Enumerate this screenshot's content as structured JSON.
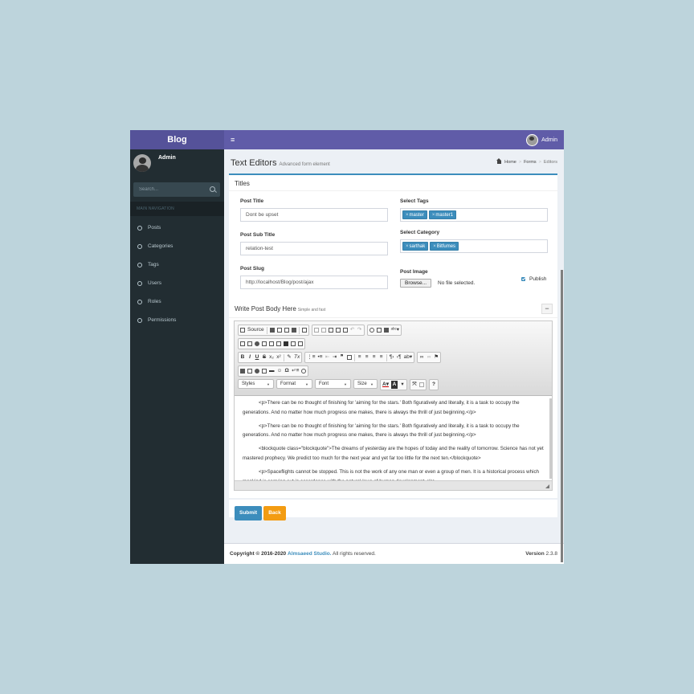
{
  "header": {
    "logo": "Blog",
    "toggle_icon": "≡",
    "user_name": "Admin"
  },
  "sidebar": {
    "user_name": "Admin",
    "search_placeholder": "Search...",
    "section_header": "MAIN NAVIGATION",
    "items": [
      {
        "label": "Posts"
      },
      {
        "label": "Categories"
      },
      {
        "label": "Tags"
      },
      {
        "label": "Users"
      },
      {
        "label": "Roles"
      },
      {
        "label": "Permissions"
      }
    ]
  },
  "page": {
    "title": "Text Editors",
    "subtitle": "Advanced form element",
    "breadcrumb": [
      "Home",
      "Forms",
      "Editors"
    ]
  },
  "titles_box": {
    "title": "Titles",
    "post_title_label": "Post Title",
    "post_title_value": "Dont be upset",
    "post_subtitle_label": "Post Sub Title",
    "post_subtitle_value": "relation-test",
    "post_slug_label": "Post Slug",
    "post_slug_value": "http://localhost/Blog/post/ajax",
    "tags_label": "Select Tags",
    "tags": [
      "master",
      "master1"
    ],
    "category_label": "Select Category",
    "categories": [
      "sarthak",
      "Bitfumes"
    ],
    "image_label": "Post Image",
    "browse_label": "Browse...",
    "file_status": "No file selected.",
    "publish_label": "Publish"
  },
  "editor_box": {
    "title": "Write Post Body Here",
    "subtitle": "Simple and fast",
    "collapse_label": "−",
    "toolbar": {
      "source_label": "Source",
      "styles": "Styles",
      "format": "Format",
      "font": "Font",
      "size": "Size",
      "help": "?"
    },
    "paragraphs": [
      "<p>There can be no thought of finishing for 'aiming for the stars.' Both figuratively and literally, it is a task to occupy the generations. And no matter how much progress one makes, there is always the thrill of just beginning.</p>",
      "<p>There can be no thought of finishing for 'aiming for the stars.' Both figuratively and literally, it is a task to occupy the generations. And no matter how much progress one makes, there is always the thrill of just beginning.</p>",
      "<blockquote class=\"blockquote\">The dreams of yesterday are the hopes of today and the reality of tomorrow. Science has not yet mastered prophecy. We predict too much for the next year and yet far too little for the next ten.</blockquote>",
      "<p>Spaceflights cannot be stopped. This is not the work of any one man or even a group of men. It is a historical process which mankind is carrying out in accordance with the natural laws of human development.</p>"
    ]
  },
  "actions": {
    "submit": "Submit",
    "back": "Back"
  },
  "footer": {
    "copyright_prefix": "Copyright © 2016-2020",
    "company": "Almsaeed Studio.",
    "rights": "All rights reserved.",
    "version_label": "Version",
    "version": "2.3.8"
  },
  "colors": {
    "header": "#605ca8",
    "logo": "#555299",
    "sidebar": "#222d32",
    "primary": "#3c8dbc",
    "warning": "#f39c12",
    "background": "#bdd4dc"
  }
}
